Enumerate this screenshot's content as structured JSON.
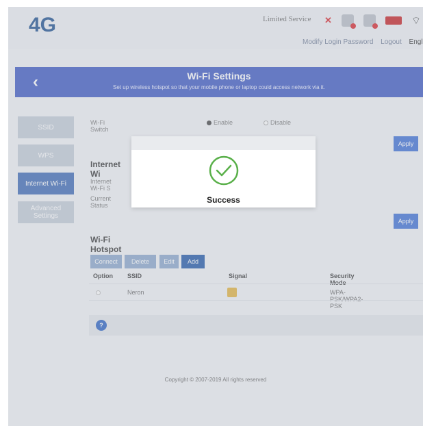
{
  "header": {
    "brand": "4G",
    "service_status": "Limited Service",
    "links": {
      "modify_password": "Modify Login Password",
      "logout": "Logout",
      "language": "English"
    }
  },
  "banner": {
    "title": "Wi-Fi Settings",
    "subtitle": "Set up wireless hotspot so that your mobile phone or laptop could access network via it."
  },
  "sidebar": {
    "items": [
      {
        "label": "SSID"
      },
      {
        "label": "WPS"
      },
      {
        "label": "Internet Wi-Fi"
      },
      {
        "label": "Advanced Settings"
      }
    ]
  },
  "main": {
    "wifi_switch_label": "Wi-Fi Switch",
    "enable_label": "Enable",
    "disable_label": "Disable",
    "apply_label": "Apply",
    "internet_wifi_title": "Internet Wi",
    "internet_wifi_field": "Internet Wi-Fi S",
    "current_status_label": "Current Status",
    "hotspot_title": "Wi-Fi Hotspot",
    "buttons": {
      "connect": "Connect",
      "delete": "Delete",
      "edit": "Edit",
      "add": "Add"
    },
    "table": {
      "headers": [
        "Option",
        "SSID",
        "Signal",
        "Security Mode"
      ],
      "rows": [
        {
          "ssid": "Neron",
          "security": "WPA-PSK/WPA2-PSK"
        }
      ]
    },
    "pager_label": "?"
  },
  "footer": {
    "copyright": "Copyright © 2007-2019 All rights reserved"
  },
  "modal": {
    "message": "Success"
  }
}
